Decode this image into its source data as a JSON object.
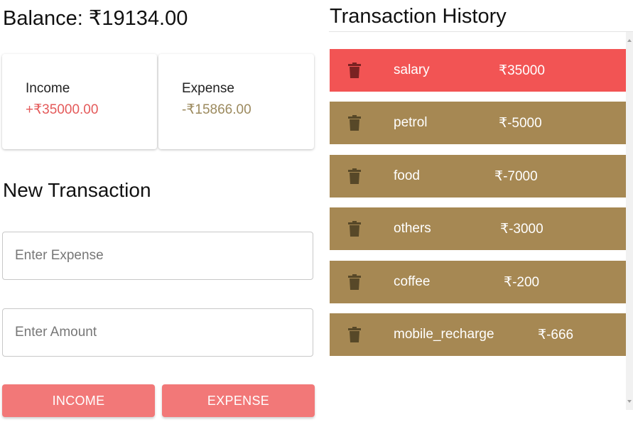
{
  "summary": {
    "balance": "Balance: ₹19134.00",
    "income_label": "Income",
    "income_value": "+₹35000.00",
    "expense_label": "Expense",
    "expense_value": "-₹15866.00"
  },
  "form": {
    "title": "New Transaction",
    "expense_placeholder": "Enter Expense",
    "amount_placeholder": "Enter Amount",
    "income_button": "INCOME",
    "expense_button": "EXPENSE"
  },
  "history": {
    "title": "Transaction History",
    "items": [
      {
        "name": "salary",
        "amount": "₹35000",
        "type": "income"
      },
      {
        "name": "petrol",
        "amount": "₹-5000",
        "type": "expense"
      },
      {
        "name": "food",
        "amount": "₹-7000",
        "type": "expense"
      },
      {
        "name": "others",
        "amount": "₹-3000",
        "type": "expense"
      },
      {
        "name": "coffee",
        "amount": "₹-200",
        "type": "expense"
      },
      {
        "name": "mobile_recharge",
        "amount": "₹-666",
        "type": "expense"
      }
    ]
  },
  "colors": {
    "income_row": "#f25454",
    "expense_row": "#a68853",
    "income_trash": "#7a2222",
    "expense_trash": "#574828",
    "button": "#f27878",
    "income_text": "#e45a5a",
    "expense_text": "#9c8a5e"
  },
  "icons": {
    "delete": "trash-icon"
  }
}
